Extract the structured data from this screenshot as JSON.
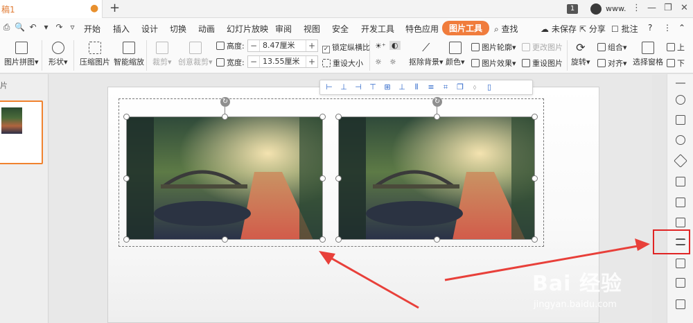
{
  "titlebar": {
    "doc_tab": "稿1",
    "new_tab": "+",
    "page_count": "1",
    "user_name": "www.",
    "win_menu": "⋮",
    "win_minimize": "—",
    "win_restore": "❐",
    "win_close": "✕"
  },
  "menubar": {
    "quick_tools": [
      "⎙",
      "🔍",
      "↶",
      "▾",
      "↷",
      "▿"
    ],
    "items": [
      "开始",
      "插入",
      "设计",
      "切换",
      "动画",
      "幻灯片放映",
      "审阅",
      "视图",
      "安全",
      "开发工具",
      "特色应用"
    ],
    "active": "图片工具",
    "search": "查找",
    "unsaved": "未保存",
    "share": "分享",
    "comment": "批注",
    "help": "?",
    "more": "⋮",
    "collapse": "⌃"
  },
  "ribbon": {
    "picture_collage": "图片拼图",
    "shape": "形状",
    "compress": "压缩图片",
    "smart_zoom": "智能缩放",
    "crop": "裁剪",
    "creative_crop": "创意裁剪",
    "height_label": "高度:",
    "height_value": "8.47厘米",
    "width_label": "宽度:",
    "width_value": "13.55厘米",
    "lock_ratio": "锁定纵横比",
    "reset_size": "重设大小",
    "remove_bg": "抠除背景",
    "color": "颜色",
    "outline": "图片轮廓",
    "effect": "图片效果",
    "change_pic": "更改图片",
    "reset_pic": "重设图片",
    "rotate": "旋转",
    "group": "组合",
    "align": "对齐",
    "select_pane": "选择窗格",
    "up": "上",
    "down": "下"
  },
  "left_panel": {
    "tab_label": "片"
  },
  "watermark": {
    "brand": "Bai 经验",
    "url": "jingyan.baidu.com"
  },
  "colors": {
    "accent": "#f07c3c",
    "highlight": "#e02424",
    "annotation_arrow": "#e8403a"
  }
}
